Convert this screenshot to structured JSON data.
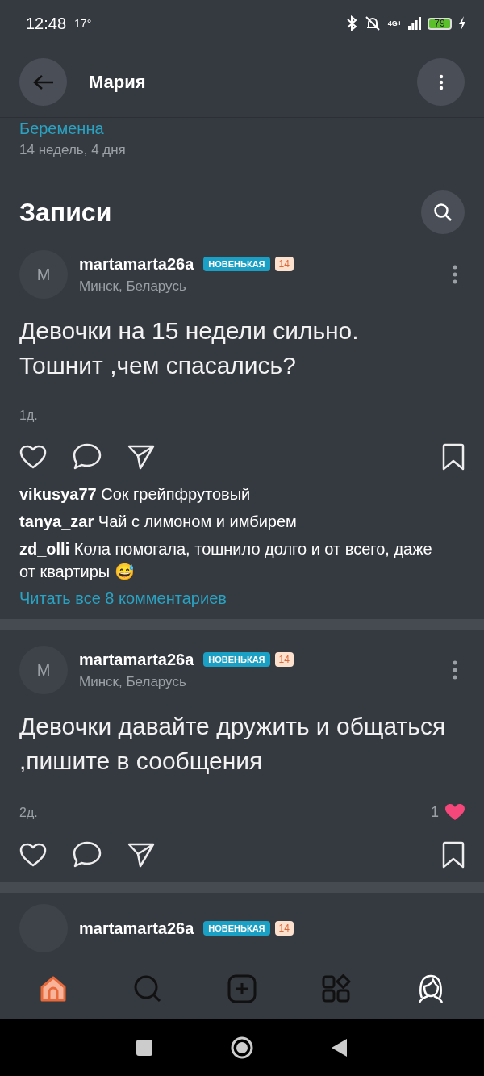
{
  "status_bar": {
    "time": "12:48",
    "temperature": "17°",
    "network": "4G+",
    "battery": "79"
  },
  "header": {
    "title": "Мария"
  },
  "profile": {
    "status": "Беременна",
    "term": "14 недель, 4 дня"
  },
  "section": {
    "title": "Записи"
  },
  "posts": [
    {
      "avatar": "M",
      "author": "martamarta26a",
      "badge": "НОВЕНЬКАЯ",
      "level": "14",
      "location": "Минск, Беларусь",
      "text": "Девочки на 15 недели сильно. Тошнит ,чем спасались?",
      "time": "1д.",
      "comments": [
        {
          "author": "vikusya77",
          "text": "Сок грейпфрутовый"
        },
        {
          "author": "tanya_zar",
          "text": "Чай с лимоном и имбирем"
        },
        {
          "author": "zd_olli",
          "text": "Кола помогала, тошнило долго и от всего, даже от квартиры 😅"
        }
      ],
      "read_all": "Читать все 8 комментариев"
    },
    {
      "avatar": "M",
      "author": "martamarta26a",
      "badge": "НОВЕНЬКАЯ",
      "level": "14",
      "location": "Минск, Беларусь",
      "text": "Девочки давайте дружить и общаться ,пишите в сообщения",
      "time": "2д.",
      "likes": "1"
    },
    {
      "author": "martamarta26a",
      "badge": "НОВЕНЬКАЯ",
      "level": "14"
    }
  ],
  "bottom_nav": [
    {
      "kind": "home",
      "selected": true
    },
    {
      "kind": "search",
      "selected": false
    },
    {
      "kind": "add",
      "selected": false
    },
    {
      "kind": "apps",
      "selected": false
    },
    {
      "kind": "profile",
      "selected": false
    }
  ]
}
